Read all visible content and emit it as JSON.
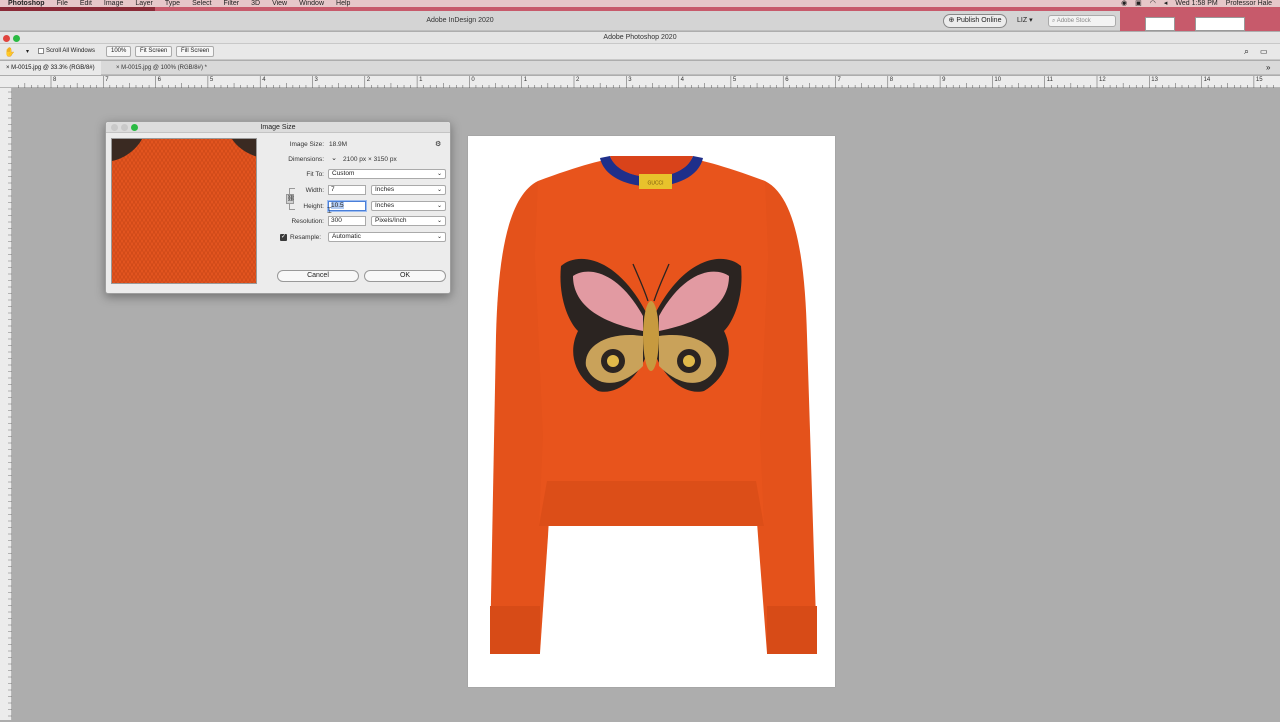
{
  "menubar": {
    "app": "Photoshop",
    "items": [
      "File",
      "Edit",
      "Image",
      "Layer",
      "Type",
      "Select",
      "Filter",
      "3D",
      "View",
      "Window",
      "Help"
    ],
    "clock": "Wed 1:58 PM",
    "user": "Professor Hale"
  },
  "indesign": {
    "title": "Adobe InDesign 2020",
    "publish_label": "Publish Online",
    "user_label": "LIZ",
    "stock_placeholder": "Adobe Stock"
  },
  "photoshop": {
    "title": "Adobe Photoshop 2020"
  },
  "options_bar": {
    "scroll_all_label": "Scroll All Windows",
    "zoom_100": "100%",
    "fit_screen": "Fit Screen",
    "fill_screen": "Fill Screen"
  },
  "tabs": [
    {
      "label": "M-0015.jpg @ 33.3% (RGB/8#)"
    },
    {
      "label": "M-0015.jpg @ 100% (RGB/8#) *"
    }
  ],
  "ruler": {
    "top_labels": [
      "8",
      "7",
      "6",
      "5",
      "4",
      "3",
      "2",
      "1",
      "0",
      "1",
      "2",
      "3",
      "4",
      "5",
      "6",
      "7",
      "8",
      "9",
      "10",
      "11",
      "12",
      "13",
      "14",
      "15"
    ]
  },
  "dialog": {
    "title": "Image Size",
    "image_size_label": "Image Size:",
    "image_size_value": "18.9M",
    "dimensions_label": "Dimensions:",
    "dim_width": "2100 px",
    "dim_x": "×",
    "dim_height": "3150 px",
    "fit_to_label": "Fit To:",
    "fit_to_value": "Custom",
    "width_label": "Width:",
    "width_value": "7",
    "width_unit": "Inches",
    "height_label": "Height:",
    "height_value": "10.5",
    "height_unit": "Inches",
    "resolution_label": "Resolution:",
    "resolution_value": "300",
    "resolution_unit": "Pixels/Inch",
    "resample_label": "Resample:",
    "resample_checked": true,
    "resample_value": "Automatic",
    "cancel_label": "Cancel",
    "ok_label": "OK"
  },
  "garment": {
    "label_text": "GUCCI"
  },
  "colors": {
    "sweater": "#e8541c",
    "collar": "#1f2f8a",
    "accent_ok": "#f8f8f8"
  }
}
